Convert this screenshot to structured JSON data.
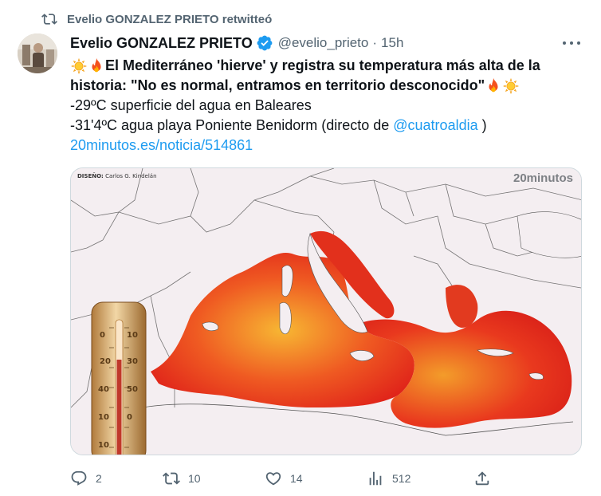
{
  "retweet": {
    "text": "Evelio GONZALEZ PRIETO retwitteó"
  },
  "tweet": {
    "author_name": "Evelio GONZALEZ PRIETO",
    "handle": "@evelio_prieto",
    "separator": "·",
    "time": "15h",
    "headline_line1": "El Mediterráneo 'hierve' y registra su temperatura más alta de la",
    "headline_line2": "historia: \"No es normal, entramos en territorio desconocido\"",
    "line3": "-29ºC superficie del agua en Baleares",
    "line4_before": "-31'4ºC agua playa Poniente Benidorm (directo de ",
    "mention": "@cuatroaldia",
    "line4_after": " )",
    "link": "20minutos.es/noticia/514861"
  },
  "media": {
    "credit_label": "DISEÑO:",
    "credit_name": "Carlos G. Kindelán",
    "brand": "20minutos",
    "thermometer_labels": [
      "0",
      "10",
      "20",
      "30",
      "40",
      "50",
      "10",
      "0",
      "10"
    ]
  },
  "actions": {
    "replies": "2",
    "retweets": "10",
    "likes": "14",
    "views": "512"
  },
  "icons": {
    "retweet": "retweet-icon",
    "verified": "verified-badge-icon",
    "more": "more-icon",
    "reply": "reply-icon",
    "like": "heart-icon",
    "views": "views-icon",
    "share": "share-icon",
    "sun": "sun-emoji-icon",
    "fire": "fire-emoji-icon"
  },
  "colors": {
    "accent": "#1d9bf0",
    "muted": "#536471",
    "heat": "#e8321e"
  }
}
